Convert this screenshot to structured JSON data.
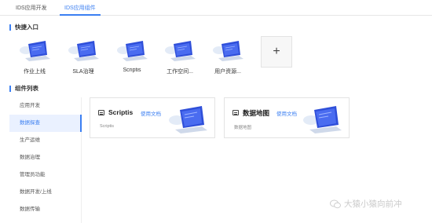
{
  "tabs": [
    {
      "label": "IDS应用开发"
    },
    {
      "label": "IDS应用组件"
    }
  ],
  "quick_entry": {
    "title": "快捷入口",
    "items": [
      {
        "label": "作业上线"
      },
      {
        "label": "SLA治理"
      },
      {
        "label": "Scriptis"
      },
      {
        "label": "工作空间..."
      },
      {
        "label": "用户资源..."
      }
    ],
    "add_label": "+"
  },
  "component_list": {
    "title": "组件列表",
    "nav": [
      {
        "label": "应用开发"
      },
      {
        "label": "数据探查"
      },
      {
        "label": "生产运维"
      },
      {
        "label": "数据治理"
      },
      {
        "label": "管理员功能"
      },
      {
        "label": "数据开发/上线"
      },
      {
        "label": "数据传输"
      }
    ],
    "active_nav": "数据探查",
    "cards": [
      {
        "title": "Scriptis",
        "doc_link": "使用文档",
        "desc": "Scriptis"
      },
      {
        "title": "数据地图",
        "doc_link": "使用文档",
        "desc": "数据地图"
      }
    ]
  },
  "watermark": {
    "text": "大猿小猿向前冲"
  },
  "colors": {
    "accent": "#3b7ff2",
    "laptop_screen": "#2f4fd9",
    "laptop_base": "#cfd9ea"
  }
}
